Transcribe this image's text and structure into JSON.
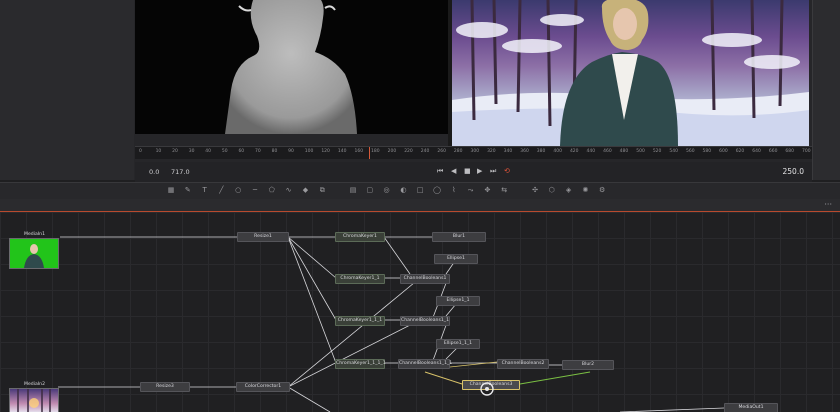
{
  "timeline": {
    "ticks": [
      "0",
      "10",
      "20",
      "30",
      "40",
      "50",
      "60",
      "70",
      "80",
      "90",
      "100",
      "120",
      "140",
      "160",
      "180",
      "200",
      "220",
      "240",
      "260",
      "280",
      "300",
      "320",
      "340",
      "360",
      "380",
      "400",
      "420",
      "440",
      "460",
      "480",
      "500",
      "520",
      "540",
      "560",
      "580",
      "600",
      "620",
      "640",
      "660",
      "680",
      "700"
    ],
    "start_tc": "0.0",
    "end_render_tc": "717.0",
    "current_frame": "250.0",
    "playhead_fraction": 0.345
  },
  "transport": {
    "skip_start": "⏮",
    "step_back": "◀",
    "stop": "■",
    "play": "▶",
    "skip_end": "⏭",
    "loop": "⟲"
  },
  "toolbar": {
    "tools": [
      "bg-icon",
      "paint-icon",
      "text-icon",
      "brush-icon",
      "circle-icon",
      "line-icon",
      "polygon-icon",
      "bezier-icon",
      "drop-icon",
      "merge-icon",
      "layers-icon",
      "screen-icon",
      "camera-icon",
      "view-icon",
      "rect-icon",
      "ellipse-icon",
      "polyline-icon",
      "xspline-icon",
      "tracker-icon",
      "warp-icon",
      "particle-icon",
      "3d-icon",
      "render-icon",
      "light-icon",
      "settings-icon"
    ]
  },
  "panel": {
    "menu": "···"
  },
  "nodes": {
    "mediain1": "MediaIn1",
    "mediain2": "MediaIn2",
    "resize1": "Resize1",
    "resize3": "Resize3",
    "colorcorrector1": "ColorCorrector1",
    "chromakeyer1": "ChromaKeyer1",
    "chromakeyer1_1": "ChromaKeyer1_1",
    "chromakeyer1_1_1": "ChromaKeyer1_1_1",
    "chromakeyer1_1_1_1": "ChromaKeyer1_1_1_1",
    "blur1": "Blur1",
    "blur2": "Blur2",
    "ellipse1": "Ellipse1",
    "ellipse1_1": "Ellipse1_1",
    "ellipse1_1_1": "Ellipse1_1_1",
    "channelbooleans1": "ChannelBooleans1",
    "channelbooleans1_1": "ChannelBooleans1_1",
    "channelbooleans1_1_1": "ChannelBooleans1_1_1",
    "channelbooleans2": "ChannelBooleans2",
    "channelbooleans3": "ChannelBooleans3",
    "mediaout1": "MediaOut1"
  },
  "colors": {
    "accent": "#b84a2e",
    "playhead": "#d65a3a",
    "wire": "#d8d8dc",
    "wire_green": "#7bc043",
    "wire_yellow": "#d9c36a",
    "greenscreen": "#22c41a"
  }
}
